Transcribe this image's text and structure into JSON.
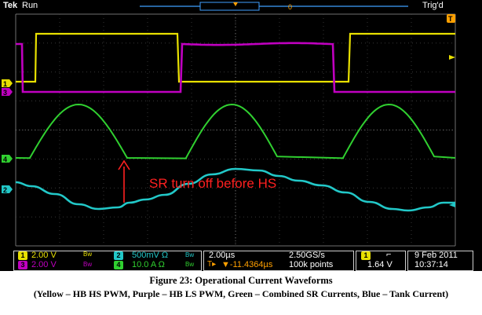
{
  "top_bar": {
    "brand": "Tek",
    "acq_state": "Run",
    "trigger_status": "Trig'd"
  },
  "annotation": {
    "text": "SR turn off before HS"
  },
  "markers": {
    "ch1": "1",
    "ch3": "3",
    "ch4": "4",
    "ch2": "2",
    "trigger_level": "T"
  },
  "channels": [
    {
      "badge": "1",
      "scale": "2.00 V",
      "coupling": "Bw",
      "color": "#e8e000"
    },
    {
      "badge": "2",
      "scale": "500mV Ω",
      "coupling": "Bw",
      "color": "#22c8c8"
    },
    {
      "badge": "3",
      "scale": "2.00 V",
      "coupling": "Bw",
      "color": "#c000c0"
    },
    {
      "badge": "4",
      "scale": "10.0 A Ω",
      "coupling": "Bw",
      "color": "#30d030"
    }
  ],
  "timebase": {
    "scale": "2.00µs",
    "sample_rate": "2.50GS/s",
    "position": "▼-11.4364µs",
    "record_length": "100k points"
  },
  "trigger": {
    "source_badge": "1",
    "slope": "⌐",
    "level": "1.64 V"
  },
  "datetime": {
    "date": "9 Feb  2011",
    "time": "10:37:14"
  },
  "caption": {
    "title": "Figure 23: Operational Current Waveforms",
    "subtitle": "(Yellow – HB HS PWM, Purple – HB LS PWM, Green – Combined SR Currents, Blue – Tank Current)"
  },
  "colors": {
    "yellow": "#e8e000",
    "purple": "#c000c0",
    "green": "#30d030",
    "cyan": "#22c8c8",
    "annotation_red": "#ff2020",
    "topbar_accent": "#ffa000"
  }
}
